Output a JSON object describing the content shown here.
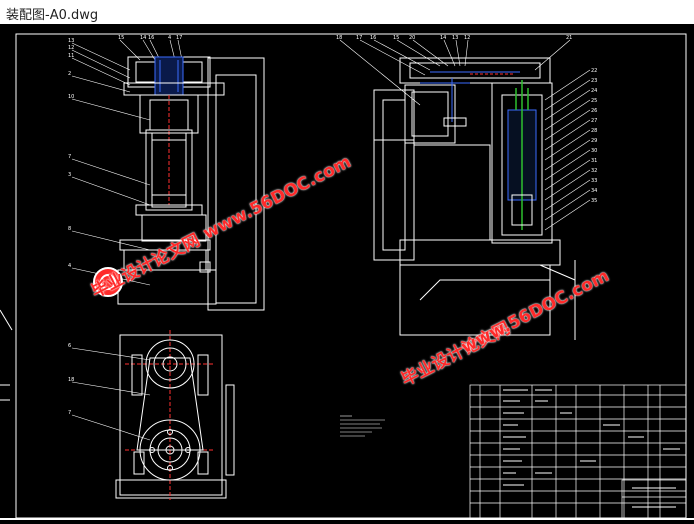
{
  "window": {
    "title": "装配图-A0.dwg"
  },
  "watermark": {
    "text_cn": "毕业设计论文网",
    "text_url": "www.56DOC.com",
    "color": "#ff2a2a"
  },
  "drawing": {
    "background": "#000000",
    "line_color": "#ffffff",
    "accent_blue": "#3b6cff",
    "accent_green": "#2ec02e",
    "accent_red": "#ff3030"
  }
}
